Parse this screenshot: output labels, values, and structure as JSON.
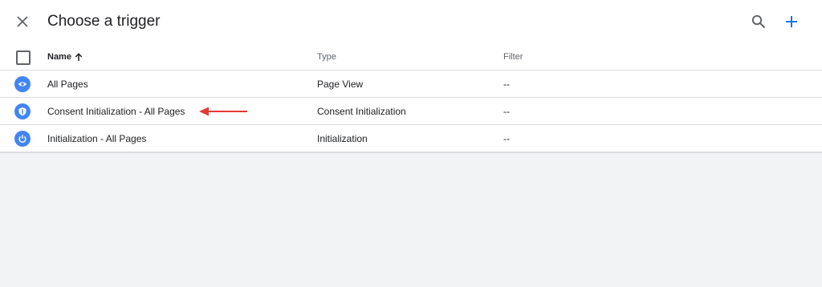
{
  "dialog": {
    "title": "Choose a trigger",
    "close_icon": "close-icon",
    "search_icon": "search-icon",
    "add_icon": "add-icon",
    "accent_color": "#1a73e8"
  },
  "table": {
    "columns": {
      "name": "Name",
      "type": "Type",
      "filter": "Filter"
    },
    "sort": {
      "column": "Name",
      "direction": "ascending"
    },
    "rows": [
      {
        "icon": "eye-icon",
        "name": "All Pages",
        "type": "Page View",
        "filter": "--"
      },
      {
        "icon": "shield-icon",
        "name": "Consent Initialization - All Pages",
        "type": "Consent Initialization",
        "filter": "--"
      },
      {
        "icon": "power-icon",
        "name": "Initialization - All Pages",
        "type": "Initialization",
        "filter": "--"
      }
    ]
  },
  "annotation": {
    "arrow_color": "#e53935"
  }
}
